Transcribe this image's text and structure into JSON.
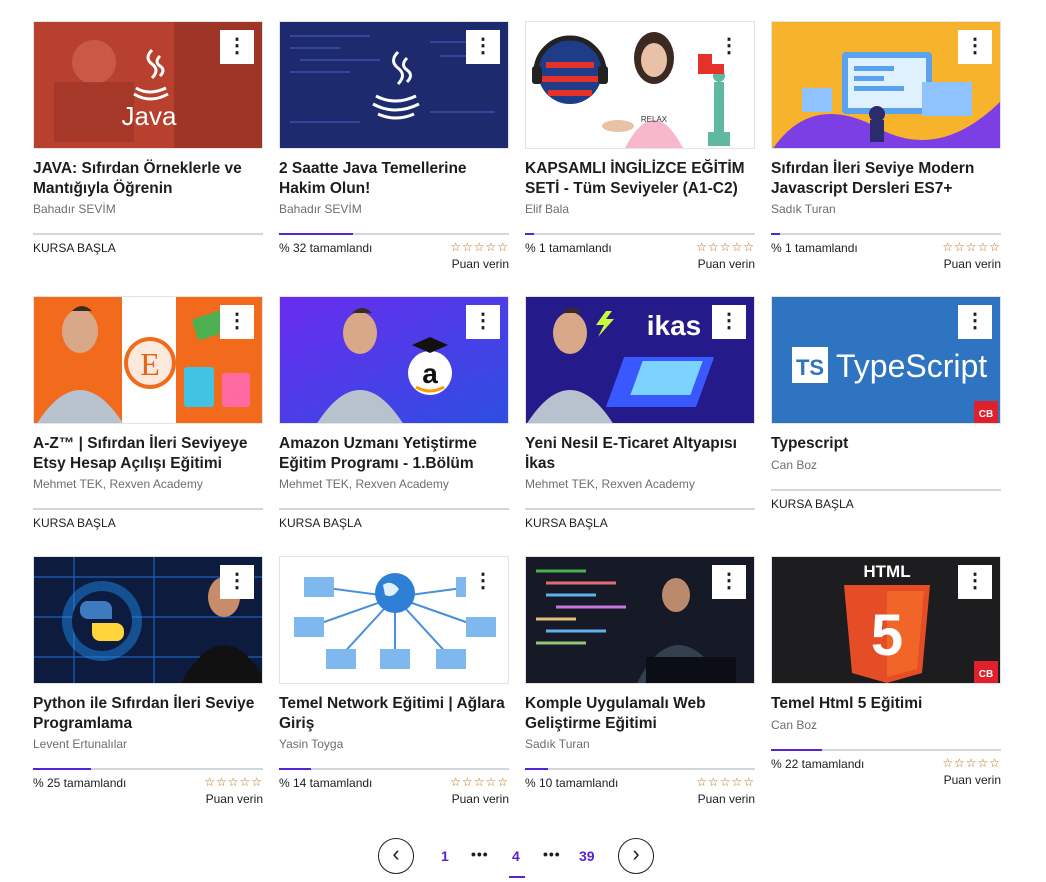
{
  "courses": [
    {
      "title": "JAVA: Sıfırdan Örneklerle ve Mantığıyla Öğrenin",
      "instructor": "Bahadır SEVİM",
      "status": "KURSA BAŞLA",
      "progress": 0,
      "thumb_text": "Java"
    },
    {
      "title": "2 Saatte Java Temellerine Hakim Olun!",
      "instructor": "Bahadır SEVİM",
      "status": "% 32 tamamlandı",
      "progress": 0.32,
      "stars": "☆☆☆☆☆",
      "rate": "Puan verin"
    },
    {
      "title": "KAPSAMLI İNGİLİZCE EĞİTİM SETİ - Tüm Seviyeler (A1-C2)",
      "instructor": "Elif Bala",
      "status": "% 1 tamamlandı",
      "progress": 0.01,
      "stars": "☆☆☆☆☆",
      "rate": "Puan verin",
      "thumb_text": "RELAX"
    },
    {
      "title": "Sıfırdan İleri Seviye Modern Javascript Dersleri ES7+",
      "instructor": "Sadık Turan",
      "status": "% 1 tamamlandı",
      "progress": 0.01,
      "stars": "☆☆☆☆☆",
      "rate": "Puan verin"
    },
    {
      "title": "A-Z™ | Sıfırdan İleri Seviyeye Etsy Hesap Açılışı Eğitimi",
      "instructor": "Mehmet TEK, Rexven Academy",
      "status": "KURSA BAŞLA",
      "progress": 0,
      "thumb_text": "E"
    },
    {
      "title": "Amazon Uzmanı Yetiştirme Eğitim Programı - 1.Bölüm",
      "instructor": "Mehmet TEK, Rexven Academy",
      "status": "KURSA BAŞLA",
      "progress": 0,
      "thumb_text": "a"
    },
    {
      "title": "Yeni Nesil E-Ticaret Altyapısı İkas",
      "instructor": "Mehmet TEK, Rexven Academy",
      "status": "KURSA BAŞLA",
      "progress": 0,
      "thumb_text": "ikas"
    },
    {
      "title": "Typescript",
      "instructor": "Can Boz",
      "status": "KURSA BAŞLA",
      "progress": 0,
      "thumb_text": "TypeScript",
      "thumb_badge": "TS",
      "thumb_logo": "CB"
    },
    {
      "title": "Python ile Sıfırdan İleri Seviye Programlama",
      "instructor": "Levent Ertunalılar",
      "status": "% 25 tamamlandı",
      "progress": 0.25,
      "stars": "☆☆☆☆☆",
      "rate": "Puan verin"
    },
    {
      "title": "Temel Network Eğitimi | Ağlara Giriş",
      "instructor": "Yasin Toyga",
      "status": "% 14 tamamlandı",
      "progress": 0.14,
      "stars": "☆☆☆☆☆",
      "rate": "Puan verin"
    },
    {
      "title": "Komple Uygulamalı Web Geliştirme Eğitimi",
      "instructor": "Sadık Turan",
      "status": "% 10 tamamlandı",
      "progress": 0.1,
      "stars": "☆☆☆☆☆",
      "rate": "Puan verin"
    },
    {
      "title": "Temel Html 5 Eğitimi",
      "instructor": "Can Boz",
      "status": "% 22 tamamlandı",
      "progress": 0.22,
      "stars": "☆☆☆☆☆",
      "rate": "Puan verin",
      "thumb_text": "HTML",
      "thumb_logo": "CB"
    }
  ],
  "menu_glyph": "⋮",
  "pagination": {
    "first": "1",
    "current": "4",
    "last": "39",
    "dots": "•••",
    "prev_icon": "‹",
    "next_icon": "›"
  },
  "colors": {
    "accent": "#5624d0",
    "star": "#b4690e",
    "muted": "#6a6f73"
  }
}
